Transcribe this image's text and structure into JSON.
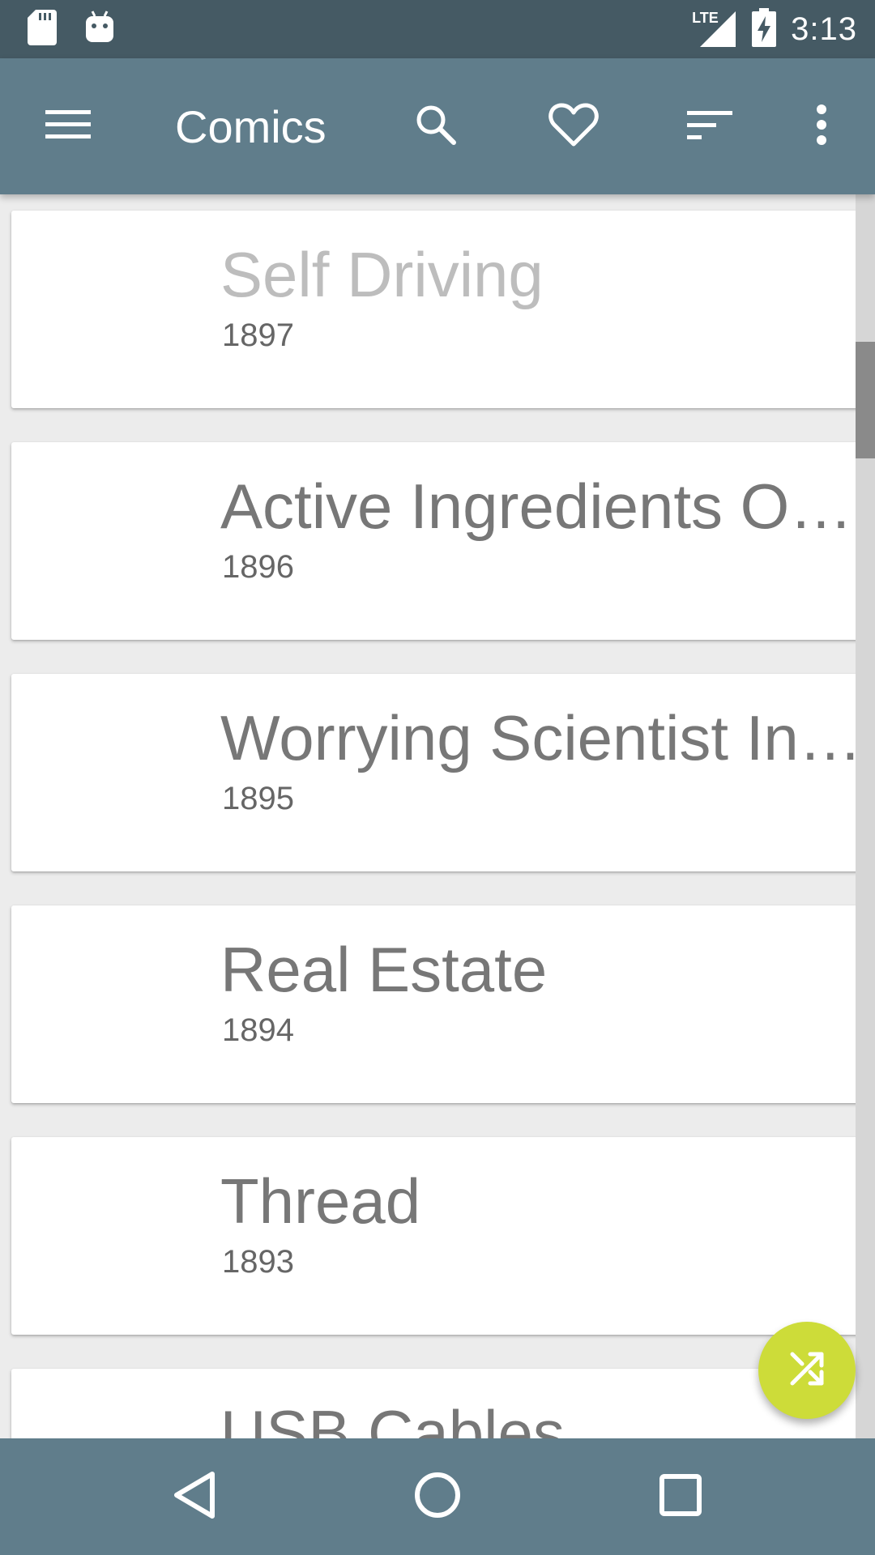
{
  "status_bar": {
    "time": "3:13",
    "network": "LTE",
    "icons": [
      "sd-card-icon",
      "android-icon",
      "lte-signal-icon",
      "battery-charging-icon"
    ]
  },
  "app_bar": {
    "title": "Comics",
    "actions": [
      "menu-icon",
      "search-icon",
      "favorite-icon",
      "sort-icon",
      "more-vert-icon"
    ]
  },
  "comics": [
    {
      "title": "Self Driving",
      "number": "1897",
      "read": true
    },
    {
      "title": "Active Ingredients O…",
      "number": "1896",
      "read": false
    },
    {
      "title": "Worrying Scientist In…",
      "number": "1895",
      "read": false
    },
    {
      "title": "Real Estate",
      "number": "1894",
      "read": false
    },
    {
      "title": "Thread",
      "number": "1893",
      "read": false
    },
    {
      "title": "USB Cables",
      "number": "",
      "read": false
    }
  ],
  "fab": {
    "icon": "shuffle-icon"
  },
  "nav_bar": {
    "buttons": [
      "back-icon",
      "home-icon",
      "recents-icon"
    ]
  },
  "colors": {
    "status_bar": "#455a64",
    "app_bar": "#607d8b",
    "fab": "#cddc39",
    "title_text": "#777777",
    "read_title_text": "#bdbdbd"
  }
}
